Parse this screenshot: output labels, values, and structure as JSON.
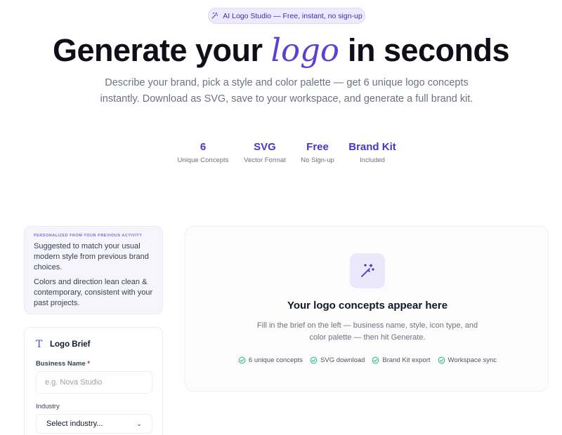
{
  "badge": {
    "icon": "magic-wand-icon",
    "text": "AI Logo Studio — Free, instant, no sign-up"
  },
  "hero": {
    "title_before": "Generate your",
    "title_accent": "logo",
    "title_after": "in seconds",
    "subtitle": "Describe your brand, pick a style and color palette — get 6 unique logo concepts instantly. Download as SVG, save to your workspace, and generate a full brand kit."
  },
  "stats": [
    {
      "value": "6",
      "label": "Unique Concepts"
    },
    {
      "value": "SVG",
      "label": "Vector Format"
    },
    {
      "value": "Free",
      "label": "No Sign-up"
    },
    {
      "value": "Brand Kit",
      "label": "Included"
    }
  ],
  "personalized": {
    "tag": "PERSONALIZED FROM YOUR PREVIOUS ACTIVITY",
    "line1": "Suggested to match your usual modern style from previous brand choices.",
    "line2": "Colors and direction lean clean & contemporary, consistent with your past projects."
  },
  "brief": {
    "icon": "text-type-icon",
    "title": "Logo Brief",
    "business_name_label": "Business Name",
    "required_mark": "*",
    "business_name_value": "",
    "business_name_placeholder": "e.g. Nova Studio",
    "industry_label": "Industry",
    "industry_selected": "Select industry..."
  },
  "preview": {
    "icon": "magic-wand-icon",
    "title": "Your logo concepts appear here",
    "subtitle": "Fill in the brief on the left — business name, style, icon type, and color palette — then hit Generate.",
    "features": [
      {
        "icon": "check-circle-icon",
        "label": "6 unique concepts"
      },
      {
        "icon": "check-circle-icon",
        "label": "SVG download"
      },
      {
        "icon": "check-circle-icon",
        "label": "Brand Kit export"
      },
      {
        "icon": "check-circle-icon",
        "label": "Workspace sync"
      }
    ]
  },
  "colors": {
    "accent": "#4338ca",
    "accent_soft": "#ede9fe",
    "success": "#10b981"
  }
}
